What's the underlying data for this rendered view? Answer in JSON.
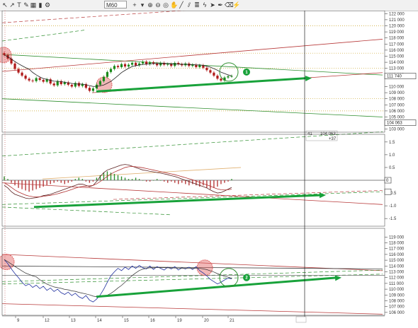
{
  "toolbar": {
    "timeframe": "M60",
    "tools": [
      {
        "name": "cursor-arrow-icon",
        "glyph": "↖"
      },
      {
        "name": "pointer-icon",
        "glyph": "↗"
      },
      {
        "name": "text-tool-icon",
        "glyph": "T"
      },
      {
        "name": "pencil-icon",
        "glyph": "✎"
      },
      {
        "name": "grid-icon",
        "glyph": "▦"
      },
      {
        "name": "chart-bars-icon",
        "glyph": "▮"
      },
      {
        "name": "settings-icon",
        "glyph": "⚙"
      },
      {
        "name": "crosshair-icon",
        "glyph": "+"
      },
      {
        "name": "dropdown-icon",
        "glyph": "▾"
      },
      {
        "name": "zoom-in-icon",
        "glyph": "⊕"
      },
      {
        "name": "zoom-out-icon",
        "glyph": "⊖"
      },
      {
        "name": "target-icon",
        "glyph": "◎"
      },
      {
        "name": "hand-icon",
        "glyph": "✋"
      },
      {
        "name": "line-tool-icon",
        "glyph": "╱"
      },
      {
        "name": "channel-tool-icon",
        "glyph": "⫽"
      },
      {
        "name": "fib-tool-icon",
        "glyph": "≣"
      },
      {
        "name": "shape-tool-icon",
        "glyph": "ϟ"
      },
      {
        "name": "arrow-tool-icon",
        "glyph": "➤"
      },
      {
        "name": "pen-tool-icon",
        "glyph": "✒"
      },
      {
        "name": "eraser-icon",
        "glyph": "⌫"
      },
      {
        "name": "indicator-icon",
        "glyph": "⚡"
      }
    ]
  },
  "colors": {
    "up_candle": "#1a8a1a",
    "down_candle": "#b01a1a",
    "red_channel": "#b83a3a",
    "green_channel": "#2f8f2f",
    "green_arrow": "#18a23a",
    "dotted_level": "#c8a020",
    "macd_hist_up": "#2f8f2f",
    "macd_hist_down": "#b83a3a",
    "macd_line": "#5a1f1f",
    "signal_line": "#b03030",
    "line_price": "#1f2f9f",
    "highlight_circle": "#e06060"
  },
  "chart_data": [
    {
      "type": "candlestick",
      "panel": "price",
      "timeframe": "M60",
      "ylim": [
        102500,
        122500
      ],
      "y_ticks": [
        "122 000",
        "121 000",
        "120 000",
        "119 000",
        "118 000",
        "117 000",
        "116 000",
        "115 000",
        "114 000",
        "113 000",
        "112 000",
        "111 740",
        "110 000",
        "109 000",
        "108 000",
        "107 000",
        "106 000",
        "105 000",
        "104 063",
        "103 000"
      ],
      "x_ticks": [
        "9",
        "12",
        "13",
        "14",
        "15",
        "16",
        "19",
        "20",
        "21"
      ],
      "current_price_label": "111 740",
      "crosshair_price_label": "104 063",
      "crosshair_time_label": "41",
      "crosshair_value_label": "104 063",
      "crosshair_extra_label": "+37",
      "annotation": "1",
      "closes": [
        115200,
        114600,
        113800,
        112900,
        112300,
        111800,
        111300,
        111000,
        110900,
        111400,
        111100,
        110800,
        111200,
        110500,
        110200,
        110900,
        110400,
        110700,
        110300,
        110000,
        110600,
        110100,
        110400,
        109800,
        109300,
        109700,
        110300,
        110900,
        111600,
        112400,
        112900,
        113400,
        113200,
        113700,
        113300,
        113600,
        113900,
        113500,
        113800,
        114100,
        113700,
        114000,
        113800,
        113500,
        113900,
        113600,
        113700,
        113400,
        113900,
        113700,
        113500,
        113800,
        113400,
        113600,
        113200,
        113500,
        113100,
        112700,
        112300,
        111800,
        111300,
        111000,
        111500,
        111700,
        111740
      ]
    },
    {
      "type": "histogram",
      "panel": "macd",
      "ylim": [
        -1.8,
        1.8
      ],
      "y_ticks": [
        "1.5",
        "1.0",
        "0.5",
        "0",
        "-0.5",
        "-1.0",
        "-1.5"
      ],
      "current_value_label": "0",
      "annotation": "none",
      "histogram": [
        0.15,
        0.05,
        -0.1,
        -0.2,
        -0.3,
        -0.35,
        -0.4,
        -0.45,
        -0.4,
        -0.35,
        -0.3,
        -0.25,
        -0.2,
        -0.15,
        -0.1,
        -0.05,
        -0.1,
        -0.15,
        -0.1,
        -0.05,
        0.05,
        0.1,
        0.05,
        -0.05,
        -0.1,
        -0.05,
        0.1,
        0.2,
        0.3,
        0.35,
        0.3,
        0.25,
        0.2,
        0.15,
        0.1,
        0.05,
        0.05,
        0.1,
        0.05,
        0,
        -0.05,
        -0.05,
        0,
        0.05,
        0,
        -0.05,
        -0.1,
        -0.05,
        -0.1,
        -0.15,
        -0.1,
        -0.15,
        -0.2,
        -0.15,
        -0.2,
        -0.25,
        -0.2,
        -0.3,
        -0.35,
        -0.3,
        -0.25,
        -0.15,
        -0.1,
        -0.05,
        0.05
      ],
      "macd_line": [
        -0.2,
        -0.3,
        -0.45,
        -0.55,
        -0.6,
        -0.65,
        -0.7,
        -0.72,
        -0.7,
        -0.68,
        -0.65,
        -0.6,
        -0.58,
        -0.55,
        -0.5,
        -0.45,
        -0.4,
        -0.35,
        -0.3,
        -0.25,
        -0.2,
        -0.15,
        -0.15,
        -0.2,
        -0.25,
        -0.2,
        -0.05,
        0.15,
        0.3,
        0.4,
        0.45,
        0.5,
        0.55,
        0.6,
        0.62,
        0.6,
        0.55,
        0.5,
        0.45,
        0.4,
        0.38,
        0.35,
        0.33,
        0.3,
        0.28,
        0.25,
        0.22,
        0.18,
        0.15,
        0.1,
        0.05,
        0,
        -0.05,
        -0.1,
        -0.15,
        -0.2,
        -0.25,
        -0.3,
        -0.38,
        -0.45,
        -0.5,
        -0.48,
        -0.42,
        -0.35,
        -0.28
      ],
      "signal_line": [
        -0.1,
        -0.18,
        -0.28,
        -0.38,
        -0.46,
        -0.52,
        -0.58,
        -0.62,
        -0.64,
        -0.65,
        -0.65,
        -0.63,
        -0.61,
        -0.59,
        -0.56,
        -0.53,
        -0.49,
        -0.45,
        -0.41,
        -0.36,
        -0.31,
        -0.27,
        -0.24,
        -0.23,
        -0.22,
        -0.2,
        -0.14,
        -0.05,
        0.05,
        0.15,
        0.24,
        0.32,
        0.38,
        0.44,
        0.5,
        0.53,
        0.54,
        0.53,
        0.51,
        0.49,
        0.46,
        0.43,
        0.4,
        0.37,
        0.34,
        0.31,
        0.28,
        0.25,
        0.22,
        0.18,
        0.14,
        0.1,
        0.06,
        0.02,
        -0.03,
        -0.08,
        -0.13,
        -0.18,
        -0.23,
        -0.29,
        -0.34,
        -0.37,
        -0.38,
        -0.37,
        -0.35
      ]
    },
    {
      "type": "line",
      "panel": "line",
      "ylim": [
        105500,
        120500
      ],
      "y_ticks": [
        "119 000",
        "118 000",
        "117 000",
        "116 000",
        "115 000",
        "114 000",
        "113 000",
        "112 000",
        "111 000",
        "110 000",
        "109 000",
        "108 000",
        "107 000",
        "106 000"
      ],
      "annotation": "2",
      "closes": [
        115100,
        114400,
        113500,
        112700,
        112000,
        111200,
        110600,
        110900,
        110300,
        110700,
        110100,
        110500,
        109800,
        110200,
        109600,
        110000,
        109400,
        109100,
        109500,
        108900,
        109300,
        108700,
        108400,
        108900,
        108100,
        107800,
        108300,
        109000,
        110000,
        111200,
        112300,
        113000,
        113600,
        113200,
        113800,
        113400,
        114000,
        113600,
        114100,
        113700,
        113500,
        114000,
        113400,
        113900,
        113600,
        113300,
        113800,
        113500,
        113900,
        113300,
        113700,
        113500,
        113800,
        113400,
        113900,
        113200,
        112800,
        112300,
        111700,
        111300,
        110900,
        111200,
        111600,
        111900,
        111800
      ]
    }
  ]
}
